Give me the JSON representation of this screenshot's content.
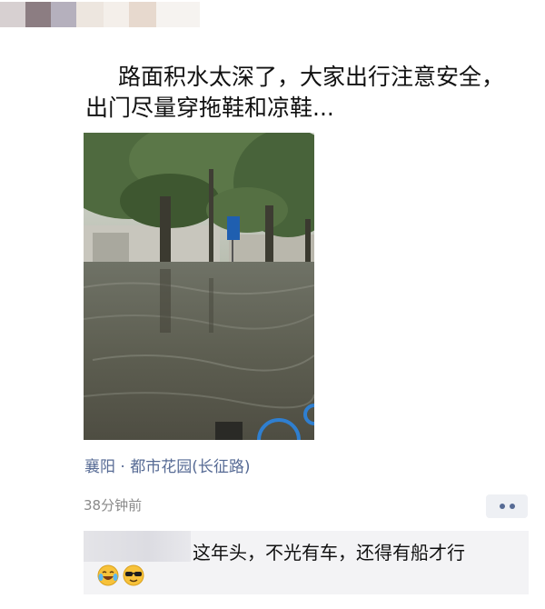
{
  "post": {
    "line1": "路面积水太深了，大家出行注意安全，",
    "line2": "出门尽量穿拖鞋和凉鞋..."
  },
  "location": "襄阳 · 都市花园(长征路)",
  "timestamp": "38分钟前",
  "comment": {
    "text": "这年头，不光有车，还得有船才行",
    "emojis": [
      "laugh-cry-emoji",
      "sunglasses-emoji"
    ]
  },
  "colors": {
    "link": "#576b95",
    "meta": "#8a8a8a",
    "comment_bg": "#f3f3f5",
    "more_bg": "#eef0f4"
  }
}
